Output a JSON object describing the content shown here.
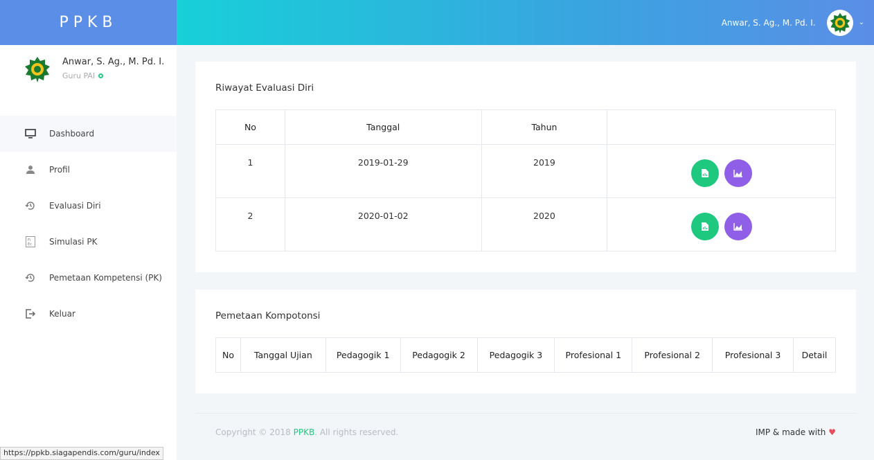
{
  "brand": {
    "title": "PPKB"
  },
  "topbar": {
    "user_name": "Anwar, S. Ag., M. Pd. I.",
    "chevron": "⌄"
  },
  "sidebar": {
    "profile": {
      "name": "Anwar, S. Ag., M. Pd. I.",
      "role": "Guru PAI"
    },
    "items": [
      {
        "label": "Dashboard",
        "icon": "monitor-icon"
      },
      {
        "label": "Profil",
        "icon": "user-icon"
      },
      {
        "label": "Evaluasi Diri",
        "icon": "history-icon"
      },
      {
        "label": "Simulasi PK",
        "icon": "periodic-table-icon"
      },
      {
        "label": "Pemetaan Kompetensi (PK)",
        "icon": "history-icon"
      },
      {
        "label": "Keluar",
        "icon": "logout-icon"
      }
    ]
  },
  "riwayat": {
    "title": "Riwayat Evaluasi Diri",
    "headers": [
      "No",
      "Tanggal",
      "Tahun",
      ""
    ],
    "rows": [
      {
        "no": "1",
        "tanggal": "2019-01-29",
        "tahun": "2019"
      },
      {
        "no": "2",
        "tanggal": "2020-01-02",
        "tahun": "2020"
      }
    ]
  },
  "pemetaan": {
    "title": "Pemetaan Kompotonsi",
    "headers": [
      "No",
      "Tanggal Ujian",
      "Pedagogik 1",
      "Pedagogik 2",
      "Pedagogik 3",
      "Profesional 1",
      "Profesional 2",
      "Profesional 3",
      "Detail"
    ]
  },
  "footer": {
    "copyright_prefix": "Copyright © 2018 ",
    "brand": "PPKB",
    "copyright_suffix": ". All rights reserved.",
    "made_with": "IMP & made with ",
    "heart": "♥"
  },
  "statusbar": {
    "url": "https://ppkb.siagapendis.com/guru/index"
  },
  "colors": {
    "green": "#1ec97f",
    "purple": "#8f5fe8",
    "brand_blue": "#5b8ee6",
    "cyan": "#17d0d8"
  }
}
